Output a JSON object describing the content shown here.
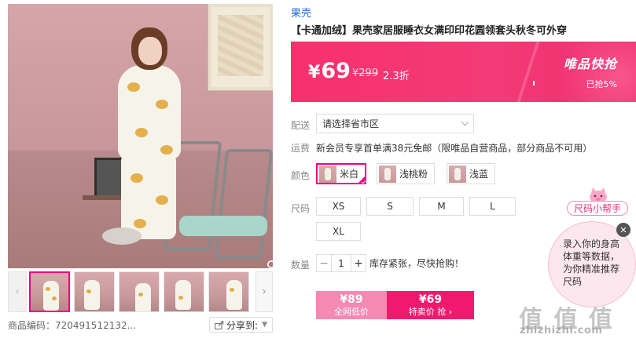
{
  "brand": "果壳",
  "title": "【卡通加绒】果壳家居服睡衣女满印印花圆领套头秋冬可外穿",
  "price": {
    "currency": "¥",
    "current": "69",
    "original": "¥299",
    "discount": "2.3折",
    "flash_label": "唯品快抢",
    "flash_sold": "已抢5%",
    "flash_progress": 0.05
  },
  "delivery": {
    "label": "配送",
    "select_value": "请选择省市区"
  },
  "shipping": {
    "label": "运费",
    "text": "新会员专享首单满38元免邮（限唯品自营商品，部分商品不可用）"
  },
  "colors": {
    "label": "颜色",
    "options": [
      {
        "label": "米白",
        "selected": true
      },
      {
        "label": "浅桃粉",
        "selected": false
      },
      {
        "label": "浅蓝",
        "selected": false
      }
    ]
  },
  "sizes": {
    "label": "尺码",
    "options": [
      "XS",
      "S",
      "M",
      "L",
      "XL"
    ]
  },
  "quantity": {
    "label": "数量",
    "minus": "−",
    "value": "1",
    "plus": "+",
    "stock_text": "库存紧张，尽快抢购！"
  },
  "buy": {
    "normal_price": "¥89",
    "normal_sub": "全网低价",
    "flash_price": "¥69",
    "flash_sub": "特卖价 抢 ›"
  },
  "gallery": {
    "sku_text": "商品编码：720491512132...",
    "share_label": "分享到:"
  },
  "size_helper": {
    "tag": "尺码小帮手",
    "message": "录入你的身高体重等数据，为你精准推荐尺码",
    "close": "✕"
  },
  "watermark": {
    "logo": "值 值 值",
    "url": "zhizhizhi.com"
  },
  "icons": {
    "zoom": "search-icon",
    "prev": "chevron-left-icon",
    "next": "chevron-right-icon",
    "share": "share-icon"
  },
  "colors_theme": {
    "accent": "#f10180",
    "banner": "#f7306f",
    "brand_link": "#1f6fd1"
  }
}
